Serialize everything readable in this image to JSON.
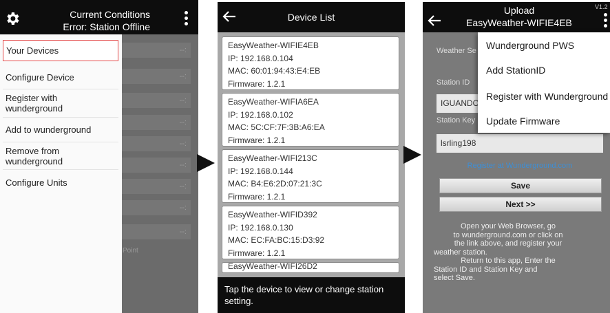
{
  "screen1": {
    "title_line1": "Current Conditions",
    "title_line2": "Error: Station Offline",
    "menu": [
      {
        "label_1": "Your Devices",
        "label_2": ""
      },
      {
        "label_1": "Configure Device",
        "label_2": ""
      },
      {
        "label_1": "Register with",
        "label_2": "wunderground"
      },
      {
        "label_1": "Add to wunderground",
        "label_2": ""
      },
      {
        "label_1": "Remove from",
        "label_2": "wunderground"
      },
      {
        "label_1": "Configure Units",
        "label_2": ""
      }
    ],
    "bg_values": [
      "--:",
      "--:",
      "--:",
      "--:",
      "--:",
      "--:",
      "--:",
      "--:",
      "--:",
      "--:"
    ],
    "bg_partial_label": "Point"
  },
  "screen2": {
    "title": "Device List",
    "devices": [
      {
        "name": "EasyWeather-WIFIE4EB",
        "ip": "IP: 192.168.0.104",
        "mac": "MAC: 60:01:94:43:E4:EB",
        "fw": "Firmware: 1.2.1"
      },
      {
        "name": "EasyWeather-WIFIA6EA",
        "ip": "IP: 192.168.0.102",
        "mac": "MAC: 5C:CF:7F:3B:A6:EA",
        "fw": "Firmware: 1.2.1"
      },
      {
        "name": "EasyWeather-WIFI213C",
        "ip": "IP: 192.168.0.144",
        "mac": "MAC: B4:E6:2D:07:21:3C",
        "fw": "Firmware: 1.2.1"
      },
      {
        "name": "EasyWeather-WIFID392",
        "ip": "IP: 192.168.0.130",
        "mac": "MAC: EC:FA:BC:15:D3:92",
        "fw": "Firmware: 1.2.1"
      }
    ],
    "partial_device": "EasyWeather-WIFI26D2",
    "footer": "Tap the device to view or change station setting."
  },
  "screen3": {
    "title_line1": "Upload",
    "title_line2": "EasyWeather-WIFIE4EB",
    "version": "V1.2",
    "weather_label": "Weather Se",
    "station_id_label": "Station ID",
    "station_id_value": "IGUANDO",
    "station_key_label": "Station Key",
    "station_key_value": "lsrling198",
    "register_link": "Register at Wunderground.com",
    "save_label": "Save",
    "next_label": "Next >>",
    "instructions": [
      "Open your Web Browser, go",
      "to wunderground.com or click on",
      "the link above, and register your",
      "weather station.",
      "Return to this app, Enter the",
      "Station ID and Station Key and",
      "select Save."
    ],
    "menu": [
      "Wunderground PWS",
      "Add StationID",
      "Register with Wunderground",
      "Update Firmware"
    ]
  },
  "colors": {
    "header": "#0d0d0d",
    "link": "#3d8fd6",
    "selected_border": "#e34848"
  }
}
